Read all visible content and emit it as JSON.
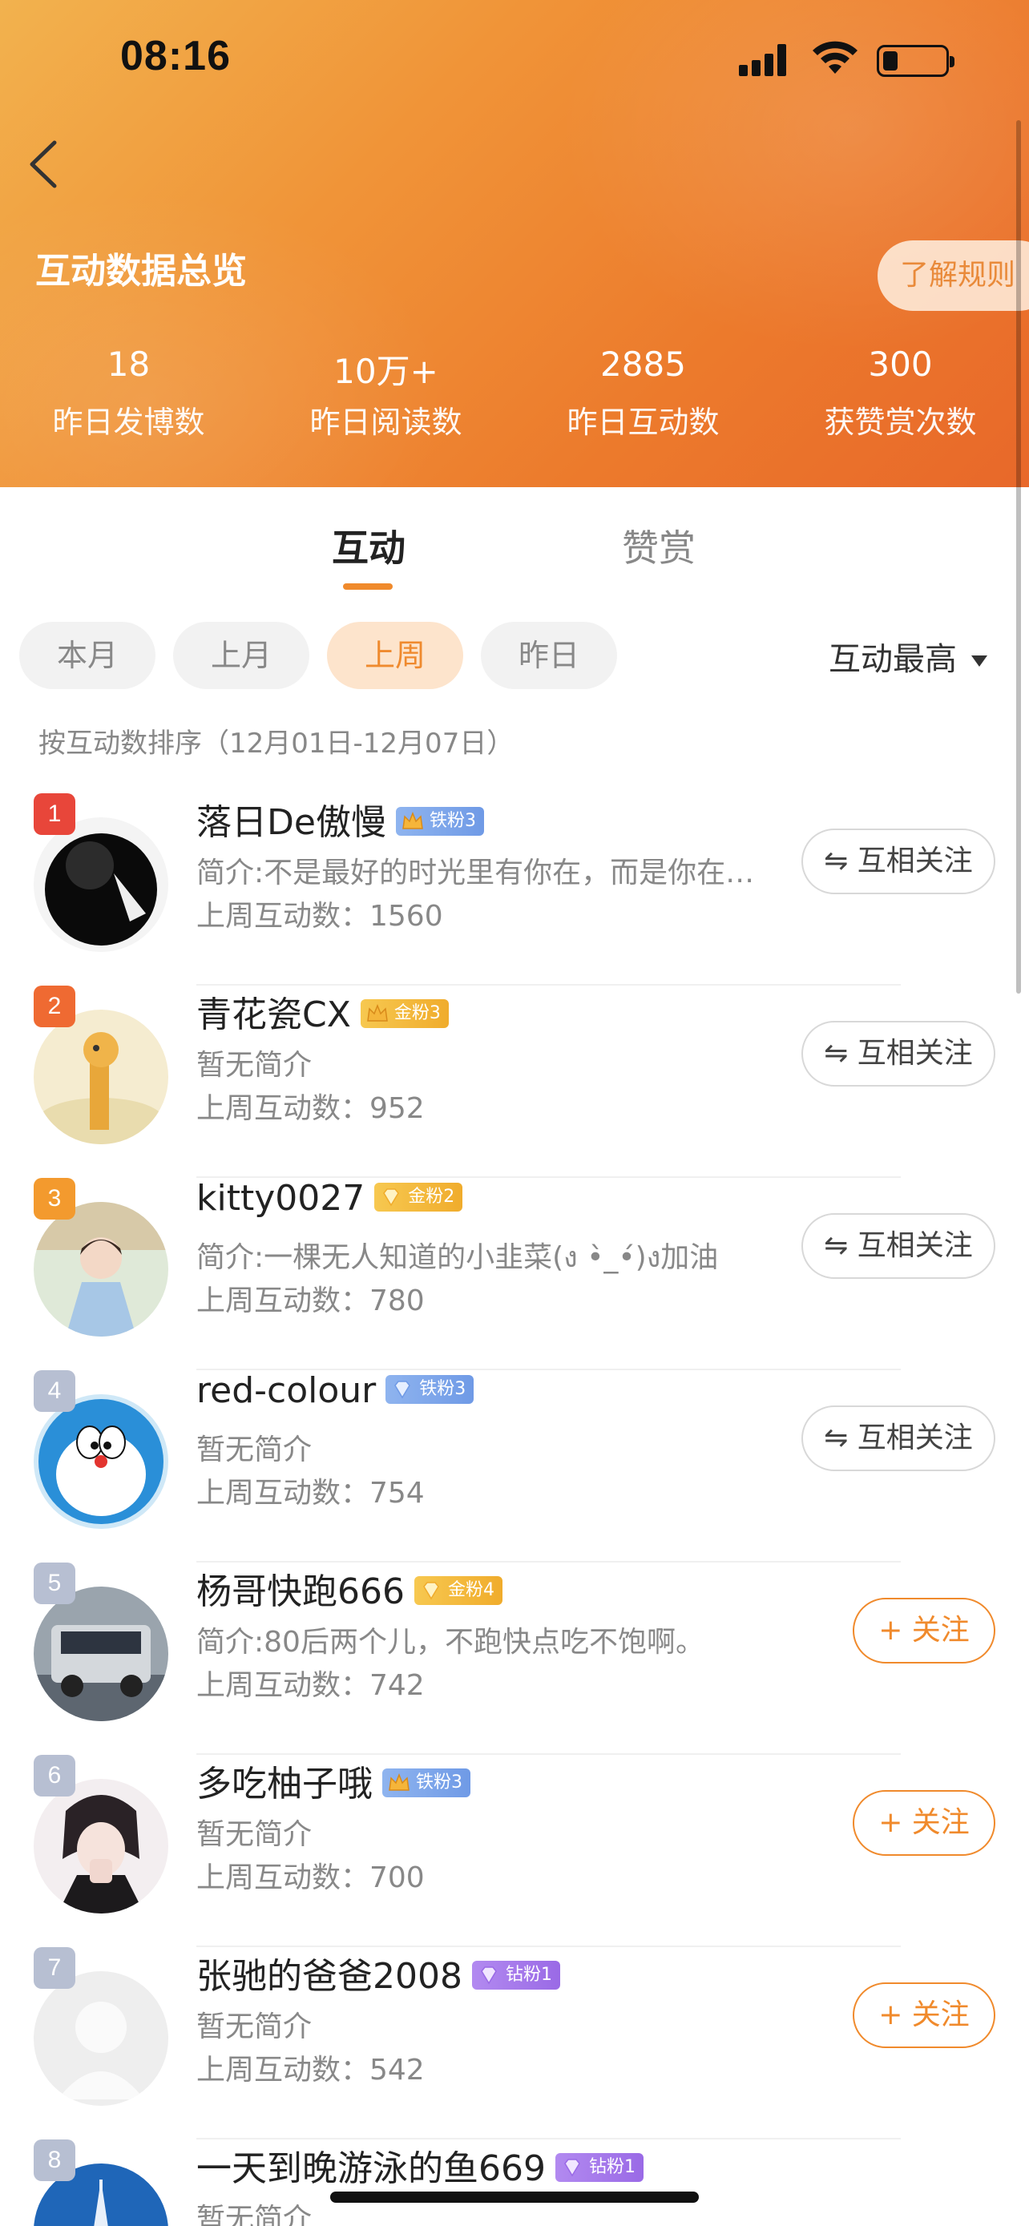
{
  "status_bar": {
    "time": "08:16"
  },
  "header": {
    "title": "互动数据总览",
    "rules_label": "了解规则",
    "stats": [
      {
        "value": "18",
        "label": "昨日发博数"
      },
      {
        "value": "10万+",
        "label": "昨日阅读数"
      },
      {
        "value": "2885",
        "label": "昨日互动数"
      },
      {
        "value": "300",
        "label": "获赞赏次数"
      }
    ],
    "colors": {
      "gradient_start": "#f2b24e",
      "gradient_end": "#e8682a"
    }
  },
  "tabs": [
    {
      "label": "互动",
      "active": true
    },
    {
      "label": "赞赏",
      "active": false
    }
  ],
  "filters": [
    {
      "label": "本月",
      "active": false
    },
    {
      "label": "上月",
      "active": false
    },
    {
      "label": "上周",
      "active": true
    },
    {
      "label": "昨日",
      "active": false
    }
  ],
  "sort": {
    "label": "互动最高"
  },
  "range_note": "按互动数排序（12月01日-12月07日）",
  "accent_color": "#f08a2c",
  "list": [
    {
      "rank": "1",
      "name": "落日De傲慢",
      "badge": "铁粉3",
      "badge_type": "iron",
      "bio": "简介:不是最好的时光里有你在，而是你在…",
      "count": "上周互动数：1560",
      "action": "⇋ 互相关注"
    },
    {
      "rank": "2",
      "name": "青花瓷CX",
      "badge": "金粉3",
      "badge_type": "gold",
      "bio": "暂无简介",
      "count": "上周互动数：952",
      "action": "⇋ 互相关注"
    },
    {
      "rank": "3",
      "name": "kitty0027",
      "badge": "金粉2",
      "badge_type": "gold",
      "bio": "简介:一棵无人知道的小韭菜(ง •̀_•́)ง加油",
      "count": "上周互动数：780",
      "action": "⇋ 互相关注"
    },
    {
      "rank": "4",
      "name": "red-colour",
      "badge": "铁粉3",
      "badge_type": "iron",
      "bio": "暂无简介",
      "count": "上周互动数：754",
      "action": "⇋ 互相关注"
    },
    {
      "rank": "5",
      "name": "杨哥快跑666",
      "badge": "金粉4",
      "badge_type": "gold",
      "bio": "简介:80后两个儿，不跑快点吃不饱啊。",
      "count": "上周互动数：742",
      "action": "+ 关注"
    },
    {
      "rank": "6",
      "name": "多吃柚子哦",
      "badge": "铁粉3",
      "badge_type": "iron",
      "bio": "暂无简介",
      "count": "上周互动数：700",
      "action": "+ 关注"
    },
    {
      "rank": "7",
      "name": "张驰的爸爸2008",
      "badge": "钻粉1",
      "badge_type": "diamond",
      "bio": "暂无简介",
      "count": "上周互动数：542",
      "action": "+ 关注"
    },
    {
      "rank": "8",
      "name": "一天到晚游泳的鱼669",
      "badge": "钻粉1",
      "badge_type": "diamond",
      "bio": "暂无简介",
      "count": "",
      "action": ""
    }
  ]
}
